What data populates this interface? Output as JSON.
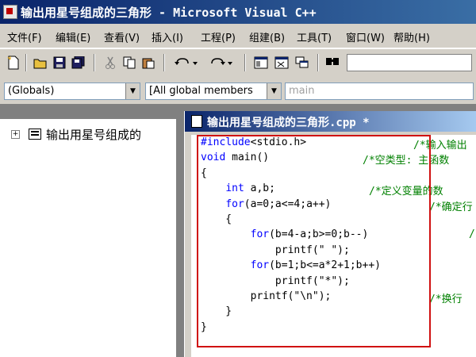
{
  "window": {
    "title": "输出用星号组成的三角形 - Microsoft Visual C++"
  },
  "menu": [
    {
      "label": "文件(F)"
    },
    {
      "label": "编辑(E)"
    },
    {
      "label": "查看(V)"
    },
    {
      "label": "插入(I)"
    },
    {
      "label": "工程(P)"
    },
    {
      "label": "组建(B)"
    },
    {
      "label": "工具(T)"
    },
    {
      "label": "窗口(W)"
    },
    {
      "label": "帮助(H)"
    }
  ],
  "toolbar": {
    "icons": [
      "new-file-icon",
      "open-folder-icon",
      "save-icon",
      "save-all-icon",
      "cut-icon",
      "copy-icon",
      "paste-icon",
      "undo-icon",
      "redo-icon",
      "workspace-icon",
      "output-icon",
      "window-list-icon",
      "find-in-files-icon"
    ],
    "search_value": ""
  },
  "wizard_bar": {
    "scope": "(Globals)",
    "members": "[All global members",
    "function": "main"
  },
  "workspace_tree": {
    "root_label": "输出用星号组成的"
  },
  "editor": {
    "doc_title": "输出用星号组成的三角形.cpp *",
    "lines": [
      {
        "code": "#include<stdio.h>",
        "comment": "/*输入输出"
      },
      {
        "code": "void main()",
        "comment": "/*空类型: 主函数"
      },
      {
        "code": "{",
        "comment": ""
      },
      {
        "code": "    int a,b;",
        "comment": "/*定义变量的数"
      },
      {
        "code": "    for(a=0;a<=4;a++)",
        "comment": "/*确定行"
      },
      {
        "code": "    {",
        "comment": ""
      },
      {
        "code": "        for(b=4-a;b>=0;b--)",
        "comment": "/"
      },
      {
        "code": "            printf(\" \");",
        "comment": ""
      },
      {
        "code": "        for(b=1;b<=a*2+1;b++)",
        "comment": ""
      },
      {
        "code": "            printf(\"*\");",
        "comment": ""
      },
      {
        "code": "        printf(\"\\n\");",
        "comment": "/*换行"
      },
      {
        "code": "    }",
        "comment": ""
      },
      {
        "code": "}",
        "comment": ""
      }
    ]
  },
  "colors": {
    "keyword": "#0000ff",
    "comment": "#008000",
    "highlight": "#d01010"
  }
}
